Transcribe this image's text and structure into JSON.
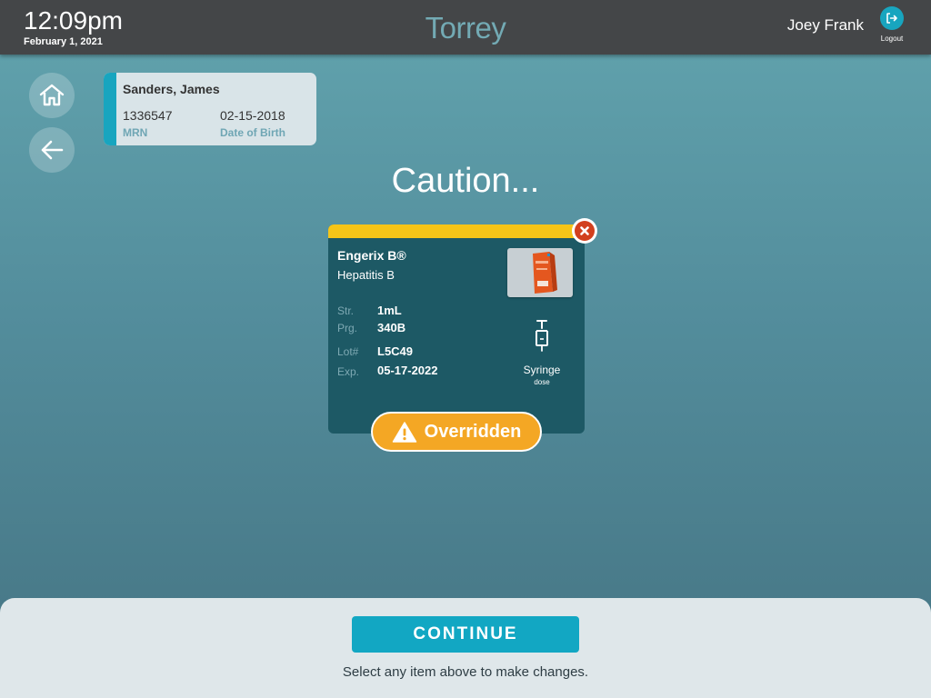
{
  "header": {
    "time": "12:09pm",
    "date": "February 1, 2021",
    "app_title": "Torrey",
    "user_name": "Joey Frank",
    "logout_label": "Logout",
    "logout_icon": "logout-icon"
  },
  "nav": {
    "home_icon": "home-icon",
    "back_icon": "arrow-left-icon"
  },
  "patient": {
    "name": "Sanders, James",
    "mrn": "1336547",
    "mrn_label": "MRN",
    "dob": "02-15-2018",
    "dob_label": "Date of Birth",
    "accent_color": "#18a5bf"
  },
  "main": {
    "title": "Caution..."
  },
  "vaccine": {
    "name": "Engerix B®",
    "description": "Hepatitis B",
    "fields": [
      {
        "label": "Str.",
        "value": "1mL"
      },
      {
        "label": "Prg.",
        "value": "340B"
      },
      {
        "label": "Lot#",
        "value": "L5C49"
      },
      {
        "label": "Exp.",
        "value": "05-17-2022"
      }
    ],
    "dose_type": "Syringe",
    "dose_sub": "dose",
    "status_bar_color": "#f5c518",
    "remove_icon": "close-icon"
  },
  "override": {
    "label": "Overridden",
    "icon": "warning-icon",
    "color": "#f4a724"
  },
  "footer": {
    "continue_label": "CONTINUE",
    "hint": "Select any item above to make changes."
  }
}
